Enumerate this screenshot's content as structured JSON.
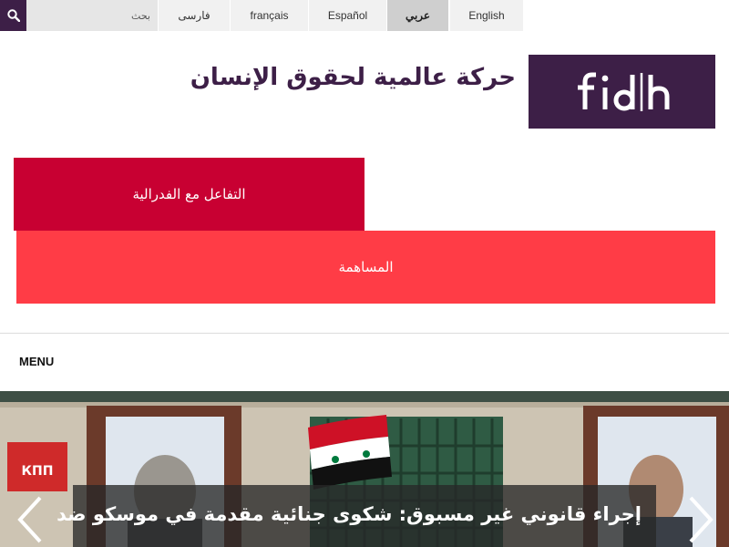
{
  "search": {
    "placeholder": "بحث"
  },
  "languages": [
    {
      "label": "فارسی"
    },
    {
      "label": "français"
    },
    {
      "label": "Español"
    },
    {
      "label": "عربي",
      "active": true
    },
    {
      "label": "English"
    }
  ],
  "header": {
    "tagline": "حركة عالمية لحقوق الإنسان",
    "logo_text": "fidh"
  },
  "actions": {
    "interact_label": "التفاعل مع الفدرالية",
    "donate_label": "المساهمة"
  },
  "nav": {
    "menu_label": "MENU"
  },
  "hero": {
    "title": "إجراء قانوني غير مسبوق: شكوى جنائية مقدمة في موسكو ضد",
    "sign_text": "КПП"
  },
  "colors": {
    "brand_purple": "#3d1f47",
    "interact_red": "#c80032",
    "donate_red": "#ff3c46"
  }
}
